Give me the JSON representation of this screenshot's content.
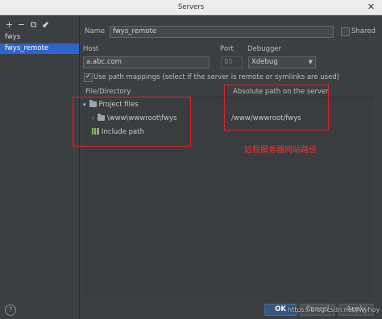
{
  "window": {
    "title": "Servers",
    "close_label": "✕"
  },
  "toolbar": {
    "add": "+",
    "remove": "−",
    "copy": "⧉",
    "edit": "⬋"
  },
  "servers": [
    {
      "label": "fwys",
      "selected": false
    },
    {
      "label": "fwys_remote",
      "selected": true
    }
  ],
  "form": {
    "name_label": "Name",
    "name_value": "fwys_remote",
    "shared_label": "Shared",
    "host_label": "Host",
    "host_value": "a.abc.com",
    "port_label": "Port",
    "port_value": "80",
    "debugger_label": "Debugger",
    "debugger_value": "Xdebug",
    "use_path_mappings_label": "Use path mappings (select if the server is remote or symlinks are used)"
  },
  "mappings": {
    "col_file": "File/Directory",
    "col_abs": "Absolute path on the server",
    "project_files": "Project files",
    "local_path": "\\www\\wwwroot\\fwys",
    "server_path": "/www/wwwroot/fwys",
    "include_path": "Include path"
  },
  "annotation": "远程服务器网站路径",
  "buttons": {
    "ok": "OK",
    "cancel": "Cancel",
    "apply": "Apply"
  },
  "help": "?",
  "watermark": "https://blog.csdn.net/fwyhoy",
  "colors": {
    "accent": "#2f65ca",
    "annotation": "#e0202a",
    "background": "#3c3f41"
  }
}
